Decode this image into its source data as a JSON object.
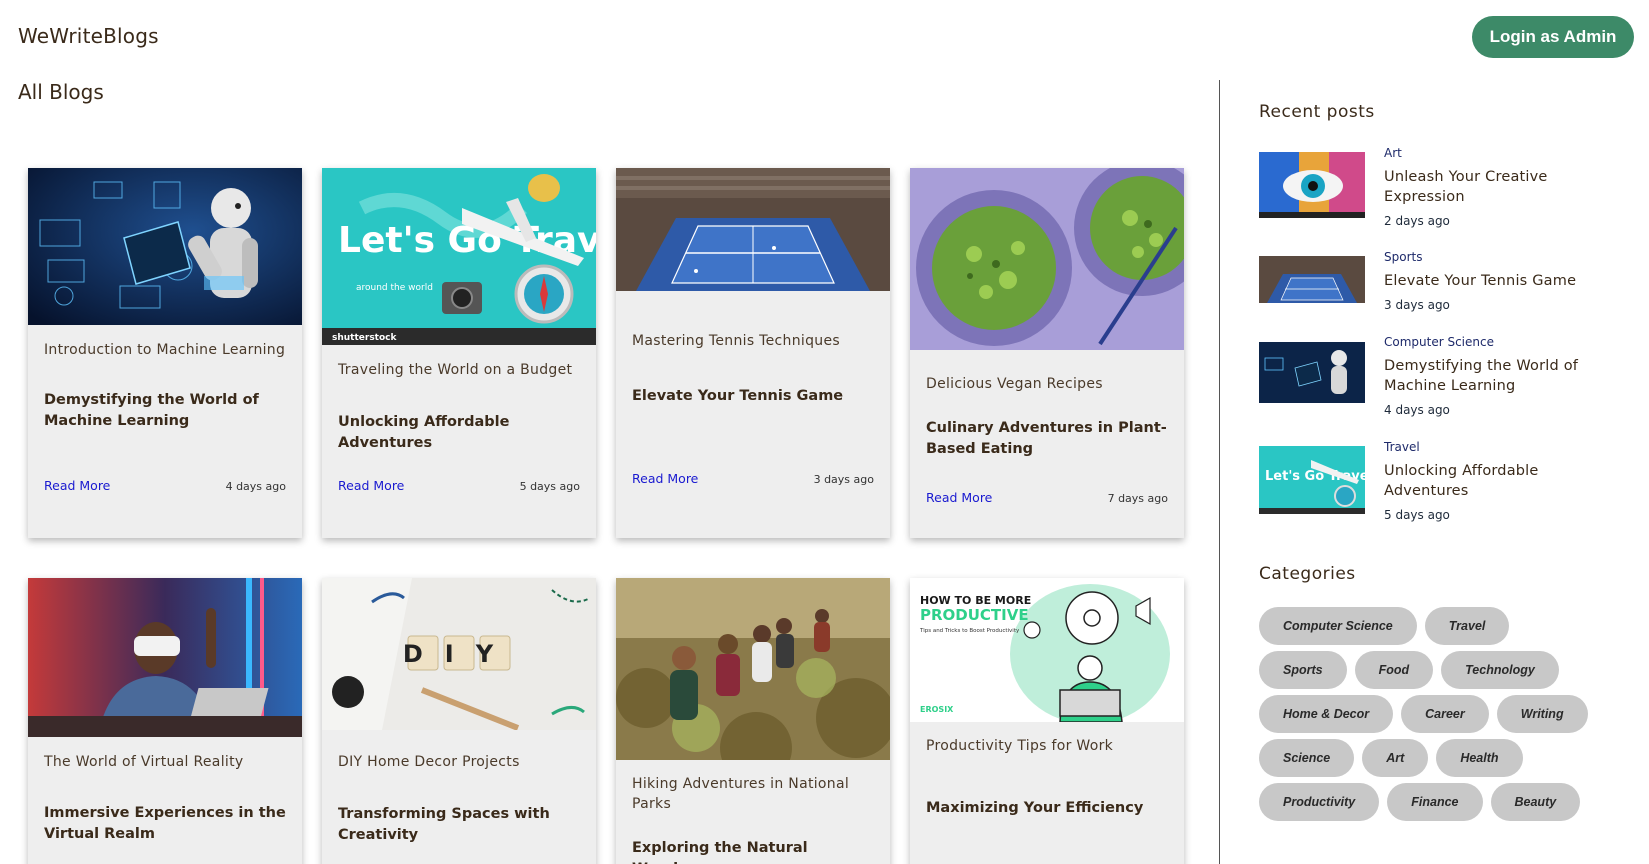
{
  "header": {
    "brand": "WeWriteBlogs",
    "login_label": "Login as Admin"
  },
  "main": {
    "heading": "All Blogs",
    "cards": [
      {
        "category": "Introduction to Machine Learning",
        "title": "Demystifying the World of Machine Learning",
        "read_more": "Read More",
        "ago": "4 days ago",
        "image": "robot-ml-image"
      },
      {
        "category": "Traveling the World on a Budget",
        "title": "Unlocking Affordable Adventures",
        "read_more": "Read More",
        "ago": "5 days ago",
        "image": "travel-image",
        "image_text": "Let's Go Travel",
        "image_sub": "around the world",
        "stock": "shutterstock"
      },
      {
        "category": "Mastering Tennis Techniques",
        "title": "Elevate Your Tennis Game",
        "read_more": "Read More",
        "ago": "3 days ago",
        "image": "tennis-court-image"
      },
      {
        "category": "Delicious Vegan Recipes",
        "title": "Culinary Adventures in Plant-Based Eating",
        "read_more": "Read More",
        "ago": "7 days ago",
        "image": "vegan-pasta-image"
      },
      {
        "category": "The World of Virtual Reality",
        "title": "Immersive Experiences in the Virtual Realm",
        "image": "vr-headset-image"
      },
      {
        "category": "DIY Home Decor Projects",
        "title": "Transforming Spaces with Creativity",
        "image": "diy-image",
        "image_text": "DIY"
      },
      {
        "category": "Hiking Adventures in National Parks",
        "title": "Exploring the Natural Wonders",
        "image": "hiking-image"
      },
      {
        "category": "Productivity Tips for Work",
        "title": "Maximizing Your Efficiency",
        "image": "productivity-image",
        "image_text": "HOW TO BE MORE",
        "image_text2": "PRODUCTIVE",
        "image_sub": "Tips and Tricks to Boost Productivity",
        "image_brand": "EROSIX"
      }
    ]
  },
  "sidebar": {
    "recent_heading": "Recent posts",
    "recent": [
      {
        "category": "Art",
        "title": "Unleash Your Creative Expression",
        "ago": "2 days ago"
      },
      {
        "category": "Sports",
        "title": "Elevate Your Tennis Game",
        "ago": "3 days ago"
      },
      {
        "category": "Computer Science",
        "title": "Demystifying the World of Machine Learning",
        "ago": "4 days ago"
      },
      {
        "category": "Travel",
        "title": "Unlocking Affordable Adventures",
        "ago": "5 days ago"
      }
    ],
    "categories_heading": "Categories",
    "categories": [
      "Computer Science",
      "Travel",
      "Sports",
      "Food",
      "Technology",
      "Home & Decor",
      "Career",
      "Writing",
      "Science",
      "Art",
      "Health",
      "Productivity",
      "Finance",
      "Beauty"
    ]
  },
  "colors": {
    "accent": "#3d8a68",
    "link": "#1a1ad0",
    "card_bg": "#eeeeee",
    "tag_bg": "#c8c8c8"
  }
}
